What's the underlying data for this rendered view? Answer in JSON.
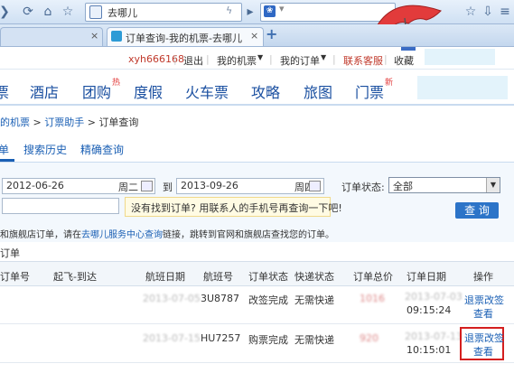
{
  "browser": {
    "site_name": "去哪儿",
    "search_placeholder": "",
    "tab_title": "订单查询-我的机票-去哪儿",
    "new_tab": "+",
    "close_tab": "×"
  },
  "topbar": {
    "username": "xyh666168",
    "logout": "退出",
    "my_tickets": "我的机票",
    "my_orders": "我的订单",
    "contact": "联系客服",
    "favorites": "收藏"
  },
  "nav": {
    "items": [
      "票",
      "酒店",
      "团购",
      "度假",
      "火车票",
      "攻略",
      "旅图",
      "门票"
    ],
    "badges": {
      "团购": "热",
      "门票": "新"
    }
  },
  "breadcrumb": {
    "parts": [
      "的机票",
      "订票助手",
      "订单查询"
    ],
    "sep": ">"
  },
  "tabs": {
    "current": "单",
    "search_history": "搜索历史",
    "precise": "精确查询"
  },
  "filters": {
    "date_from": "2012-06-26",
    "date_from_weekday": "周二",
    "to_label": "到",
    "date_to": "2013-09-26",
    "date_to_weekday": "周四",
    "status_label": "订单状态:",
    "status_value": "全部",
    "order_input": "",
    "hint": "没有找到订单? 用联系人的手机号再查询一下吧!",
    "search_button": "查 询"
  },
  "notice": {
    "pre": "和旗舰店订单，请在",
    "link": "去哪儿服务中心查询",
    "post": "链接，跳转到官网和旗舰店查找您的订单。"
  },
  "section_title": "订单",
  "table": {
    "headers": [
      "订单号",
      "起飞-到达",
      "航班日期",
      "航班号",
      "订单状态",
      "快递状态",
      "订单总价",
      "订单日期",
      "操作"
    ],
    "rows": [
      {
        "flight_date": "2013-07-05",
        "flight": "3U8787",
        "status": "改签完成",
        "delivery": "无需快递",
        "price": "1016",
        "order_date": "2013-07-03",
        "order_time": "09:15:24",
        "action1": "退票改签",
        "action2": "查看"
      },
      {
        "flight_date": "2013-07-15",
        "flight": "HU7257",
        "status": "购票完成",
        "delivery": "无需快递",
        "price": "920",
        "order_date": "2013-07-13",
        "order_time": "10:15:01",
        "action1": "退票改签",
        "action2": "查看"
      }
    ]
  },
  "colors": {
    "accent": "#1a5fb4",
    "highlight_box": "#d41f1f",
    "search_button": "#2c74c8",
    "hint_bg": "#fffbe3"
  }
}
